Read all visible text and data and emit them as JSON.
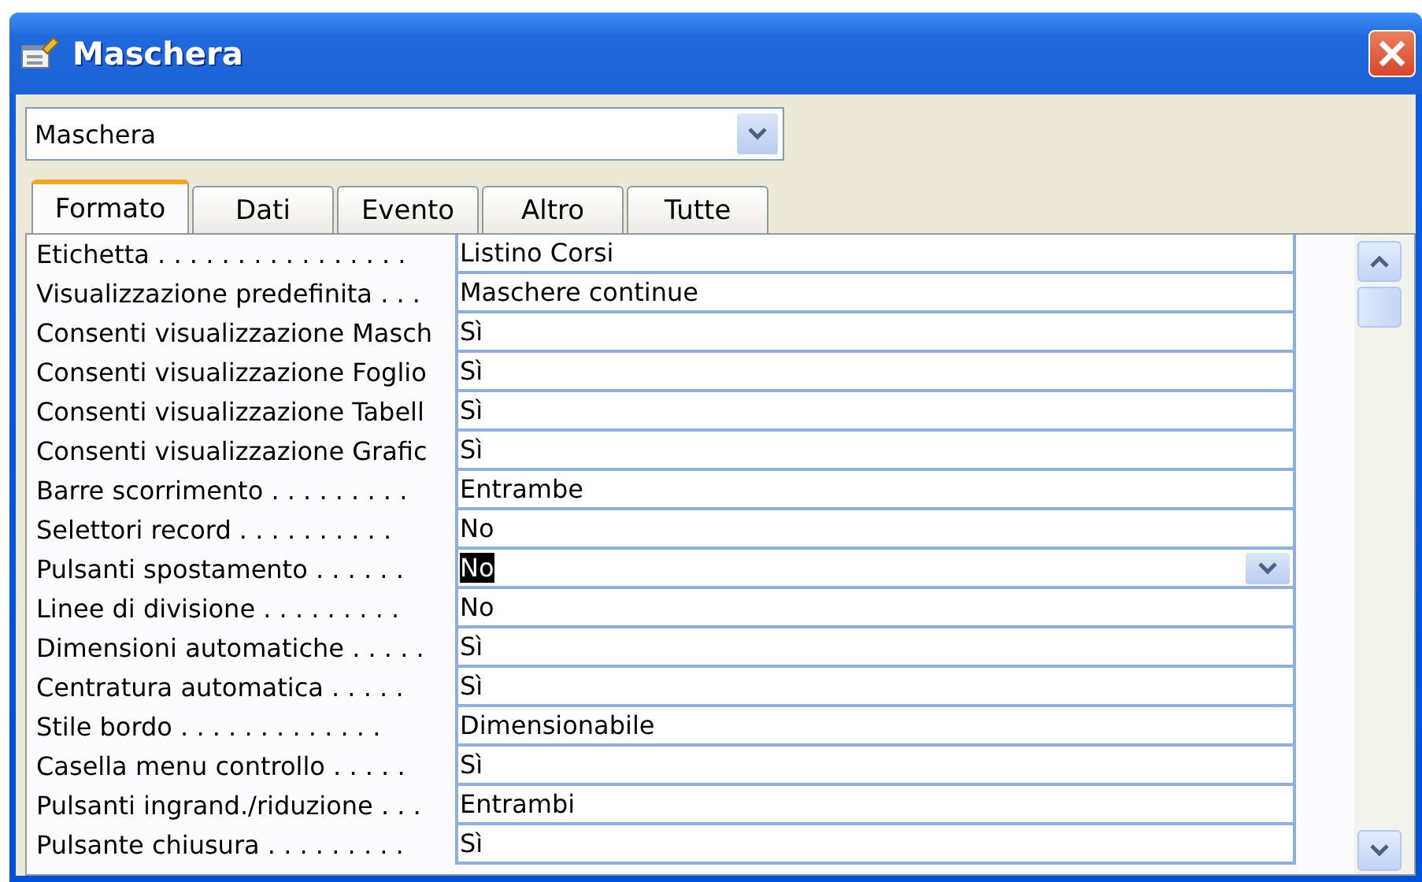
{
  "window": {
    "title": "Maschera"
  },
  "object_selector": {
    "value": "Maschera"
  },
  "tabs": [
    {
      "label": "Formato",
      "selected": true
    },
    {
      "label": "Dati",
      "selected": false
    },
    {
      "label": "Evento",
      "selected": false
    },
    {
      "label": "Altro",
      "selected": false
    },
    {
      "label": "Tutte",
      "selected": false
    }
  ],
  "properties": [
    {
      "label": "Etichetta . . . . . . . . . . . . . . . .",
      "value": "Listino Corsi",
      "selected": false
    },
    {
      "label": "Visualizzazione predefinita . . .",
      "value": "Maschere continue",
      "selected": false
    },
    {
      "label": "Consenti visualizzazione Masch",
      "value": "Sì",
      "selected": false
    },
    {
      "label": "Consenti visualizzazione Foglio",
      "value": "Sì",
      "selected": false
    },
    {
      "label": "Consenti visualizzazione Tabell",
      "value": "Sì",
      "selected": false
    },
    {
      "label": "Consenti visualizzazione Grafic",
      "value": "Sì",
      "selected": false
    },
    {
      "label": "Barre scorrimento . . . . . . . . .",
      "value": "Entrambe",
      "selected": false
    },
    {
      "label": "Selettori record . . . . . . . . . .",
      "value": "No",
      "selected": false
    },
    {
      "label": "Pulsanti spostamento . . . . . .",
      "value": "No",
      "selected": true
    },
    {
      "label": "Linee di divisione . . . . . . . . .",
      "value": "No",
      "selected": false
    },
    {
      "label": "Dimensioni automatiche . . . . .",
      "value": "Sì",
      "selected": false
    },
    {
      "label": "Centratura automatica . . . . .",
      "value": "Sì",
      "selected": false
    },
    {
      "label": "Stile bordo . . . . . . . . . . . . .",
      "value": "Dimensionabile",
      "selected": false
    },
    {
      "label": "Casella menu controllo . . . . .",
      "value": "Sì",
      "selected": false
    },
    {
      "label": "Pulsanti ingrand./riduzione . . .",
      "value": "Entrambi",
      "selected": false
    },
    {
      "label": "Pulsante chiusura . . . . . . . . .",
      "value": "Sì",
      "selected": false
    }
  ]
}
